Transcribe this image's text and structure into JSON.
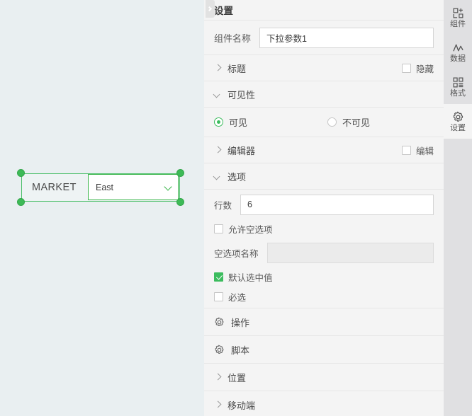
{
  "canvas": {
    "widget": {
      "name": "dropdown-parameter-widget",
      "label": "MARKET",
      "selected_value": "East",
      "dropdown_icon": "chevron-down-icon",
      "selected": true,
      "accent_color": "#3ab54a"
    },
    "background_color": "#e9eff1"
  },
  "divider": {
    "collapse_icon": "chevron-right-icon"
  },
  "panel": {
    "title": "设置",
    "component_name": {
      "label": "组件名称",
      "value": "下拉参数1"
    },
    "sections": [
      {
        "key": "title",
        "label": "标题",
        "icon": "chevron-right-icon",
        "expanded": false,
        "checkbox_label": "隐藏",
        "checkbox_checked": false
      },
      {
        "key": "visibility",
        "label": "可见性",
        "icon": "chevron-down-icon",
        "expanded": true
      },
      {
        "key": "editor",
        "label": "编辑器",
        "icon": "chevron-right-icon",
        "expanded": false,
        "checkbox_label": "编辑",
        "checkbox_checked": false
      },
      {
        "key": "options",
        "label": "选项",
        "icon": "chevron-down-icon",
        "expanded": true
      },
      {
        "key": "action",
        "label": "操作",
        "icon": "gear-icon",
        "expanded": false
      },
      {
        "key": "script",
        "label": "脚本",
        "icon": "gear-icon",
        "expanded": false
      },
      {
        "key": "position",
        "label": "位置",
        "icon": "chevron-right-icon",
        "expanded": false
      },
      {
        "key": "mobile",
        "label": "移动端",
        "icon": "chevron-right-icon",
        "expanded": false
      }
    ],
    "visibility": {
      "visible_label": "可见",
      "invisible_label": "不可见",
      "selected": "可见"
    },
    "options": {
      "rows_label": "行数",
      "rows_value": "6",
      "allow_empty_label": "允许空选项",
      "allow_empty_checked": false,
      "empty_name_label": "空选项名称",
      "empty_name_value": "",
      "empty_name_disabled": true,
      "default_selected_label": "默认选中值",
      "default_selected_checked": true,
      "required_label": "必选",
      "required_checked": false
    }
  },
  "rail": {
    "items": [
      {
        "label": "组件",
        "icon": "add-component-icon",
        "active": false
      },
      {
        "label": "数据",
        "icon": "data-chart-icon",
        "active": false
      },
      {
        "label": "格式",
        "icon": "format-grid-icon",
        "active": false
      },
      {
        "label": "设置",
        "icon": "gear-icon",
        "active": true
      }
    ]
  }
}
